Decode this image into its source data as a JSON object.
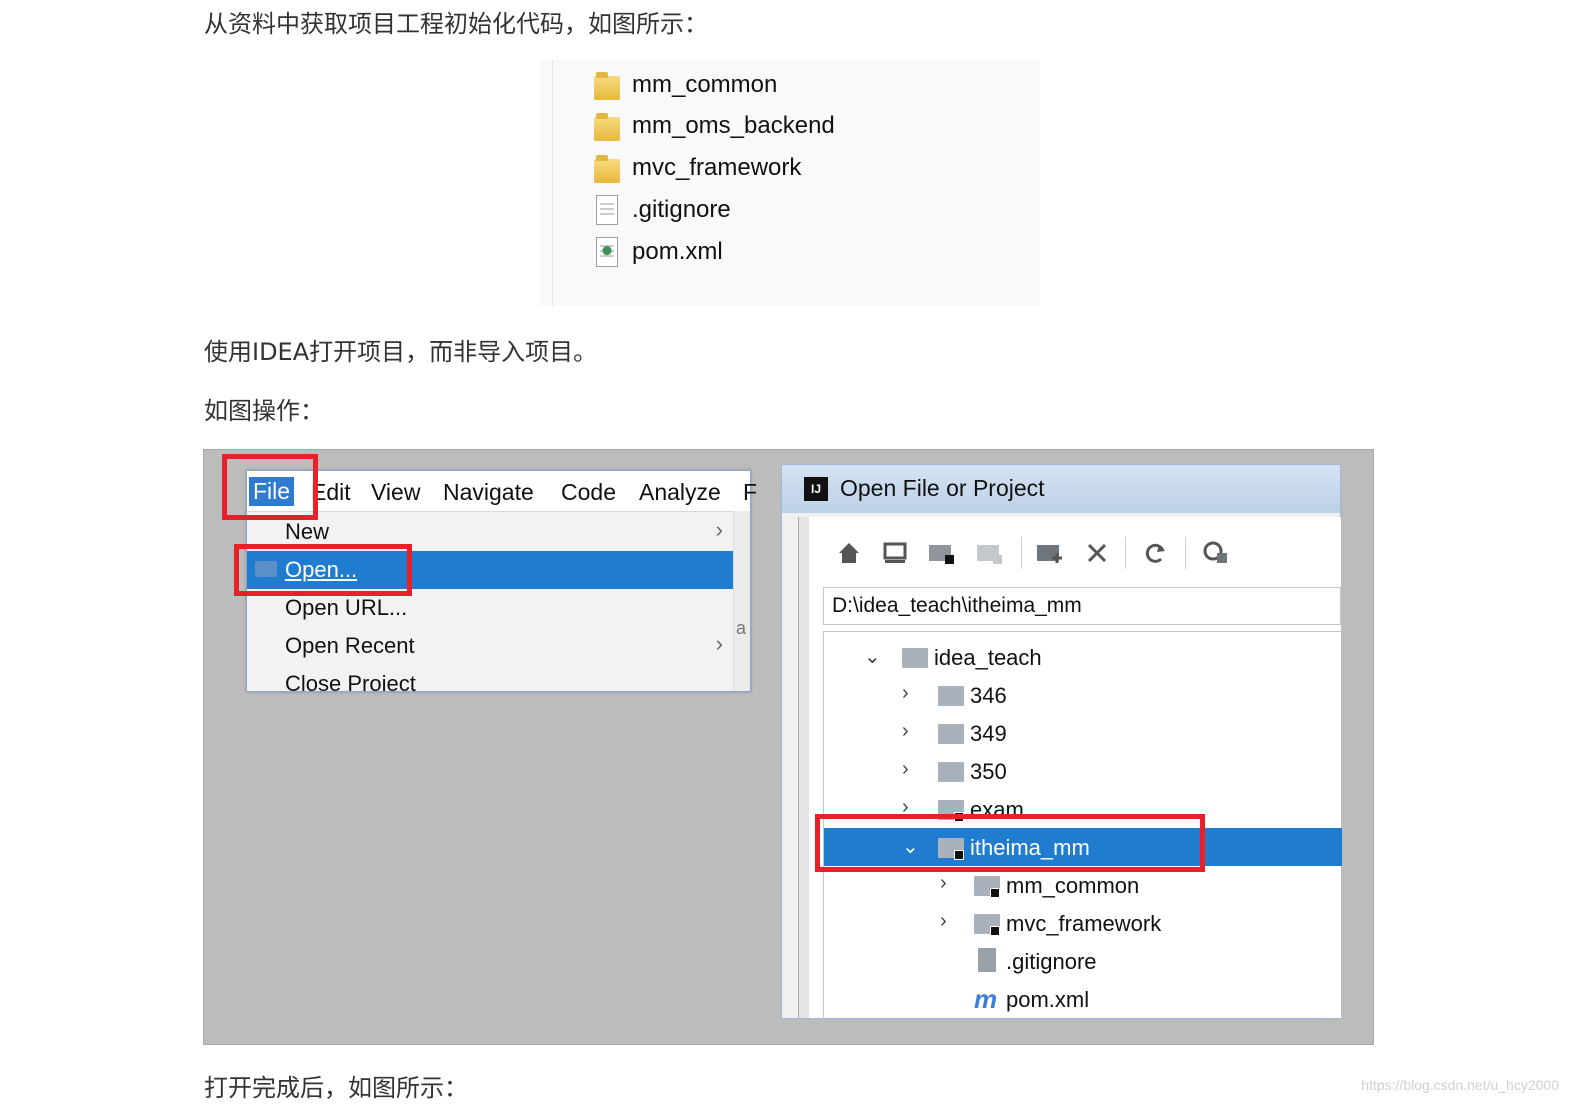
{
  "paragraphs": {
    "p1": "从资料中获取项目工程初始化代码，如图所示：",
    "p2": "使用IDEA打开项目，而非导入项目。",
    "p3": "如图操作：",
    "p4": "打开完成后，如图所示："
  },
  "explorer": {
    "items": [
      {
        "label": "mm_common",
        "icon": "folder-icon"
      },
      {
        "label": "mm_oms_backend",
        "icon": "folder-icon"
      },
      {
        "label": "mvc_framework",
        "icon": "folder-icon"
      },
      {
        "label": ".gitignore",
        "icon": "text-file-icon"
      },
      {
        "label": "pom.xml",
        "icon": "xml-file-icon"
      }
    ]
  },
  "menu": {
    "bar": [
      "File",
      "Edit",
      "View",
      "Navigate",
      "Code",
      "Analyze",
      "F"
    ],
    "items": [
      {
        "label": "New",
        "arrow": "›"
      },
      {
        "label": "Open...",
        "selected": true
      },
      {
        "label": "Open URL..."
      },
      {
        "label": "Open Recent",
        "arrow": "›"
      },
      {
        "label": "Close Project"
      }
    ],
    "behind_text": "a"
  },
  "dialog": {
    "title": "Open File or Project",
    "logo_text": "IJ",
    "path": "D:\\idea_teach\\itheima_mm",
    "toolbar_icons": [
      "home-icon",
      "desktop-icon",
      "project-folder-icon",
      "module-folder-icon",
      "new-folder-icon",
      "delete-icon",
      "refresh-icon",
      "show-hidden-icon"
    ],
    "tree": [
      {
        "label": "idea_teach",
        "level": 0,
        "chevron": "v",
        "kind": "folder"
      },
      {
        "label": "346",
        "level": 1,
        "chevron": ">",
        "kind": "folder"
      },
      {
        "label": "349",
        "level": 1,
        "chevron": ">",
        "kind": "folder"
      },
      {
        "label": "350",
        "level": 1,
        "chevron": ">",
        "kind": "folder"
      },
      {
        "label": "exam",
        "level": 1,
        "chevron": ">",
        "kind": "module"
      },
      {
        "label": "itheima_mm",
        "level": 1,
        "chevron": "v",
        "kind": "module",
        "selected": true
      },
      {
        "label": "mm_common",
        "level": 2,
        "chevron": ">",
        "kind": "module"
      },
      {
        "label": "mvc_framework",
        "level": 2,
        "chevron": ">",
        "kind": "module"
      },
      {
        "label": ".gitignore",
        "level": 2,
        "chevron": "",
        "kind": "file"
      },
      {
        "label": "pom.xml",
        "level": 2,
        "chevron": "",
        "kind": "maven"
      }
    ]
  },
  "watermark": "https://blog.csdn.net/u_hcy2000",
  "colors": {
    "selection": "#1f7ccf",
    "highlight": "#e8202a"
  }
}
